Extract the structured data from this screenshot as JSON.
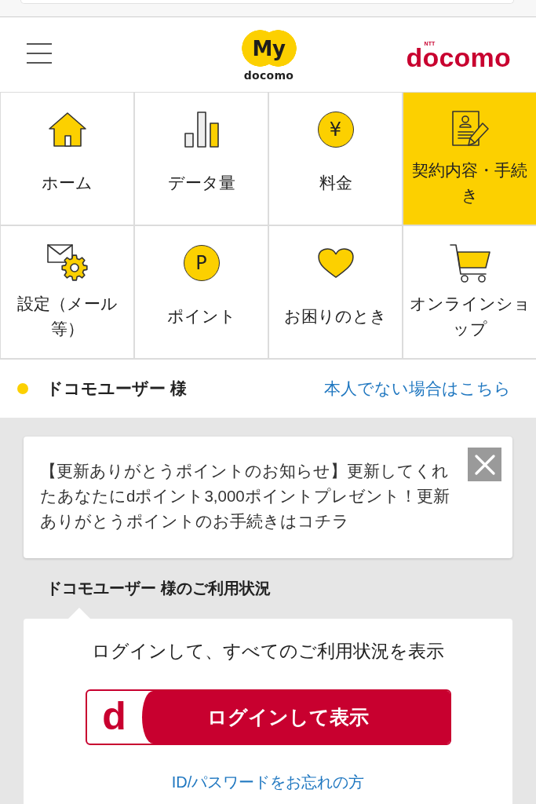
{
  "header": {
    "logo": {
      "mark": "My",
      "wordmark": "docomo"
    },
    "brand": {
      "prefix": "NTT",
      "name": "docomo"
    }
  },
  "nav": [
    {
      "label": "ホーム",
      "selected": false
    },
    {
      "label": "データ量",
      "selected": false
    },
    {
      "label": "料金",
      "glyph": "¥",
      "selected": false
    },
    {
      "label": "契約内容・手続き",
      "selected": true
    },
    {
      "label": "設定（メール等）",
      "selected": false
    },
    {
      "label": "ポイント",
      "glyph": "P",
      "selected": false
    },
    {
      "label": "お困りのとき",
      "selected": false
    },
    {
      "label": "オンラインショップ",
      "selected": false
    }
  ],
  "account": {
    "name": "ドコモユーザー 様",
    "switch_link": "本人でない場合はこちら"
  },
  "notice": {
    "text": "【更新ありがとうポイントのお知らせ】更新してくれたあなたにdポイント3,000ポイントプレゼント！更新ありがとうポイントのお手続きはコチラ"
  },
  "usage": {
    "title": "ドコモユーザー 様のご利用状況",
    "prompt": "ログインして、すべてのご利用状況を表示",
    "login_button": {
      "logo": "d",
      "label": "ログインして表示"
    },
    "forgot_link": "ID/パスワードをお忘れの方"
  }
}
